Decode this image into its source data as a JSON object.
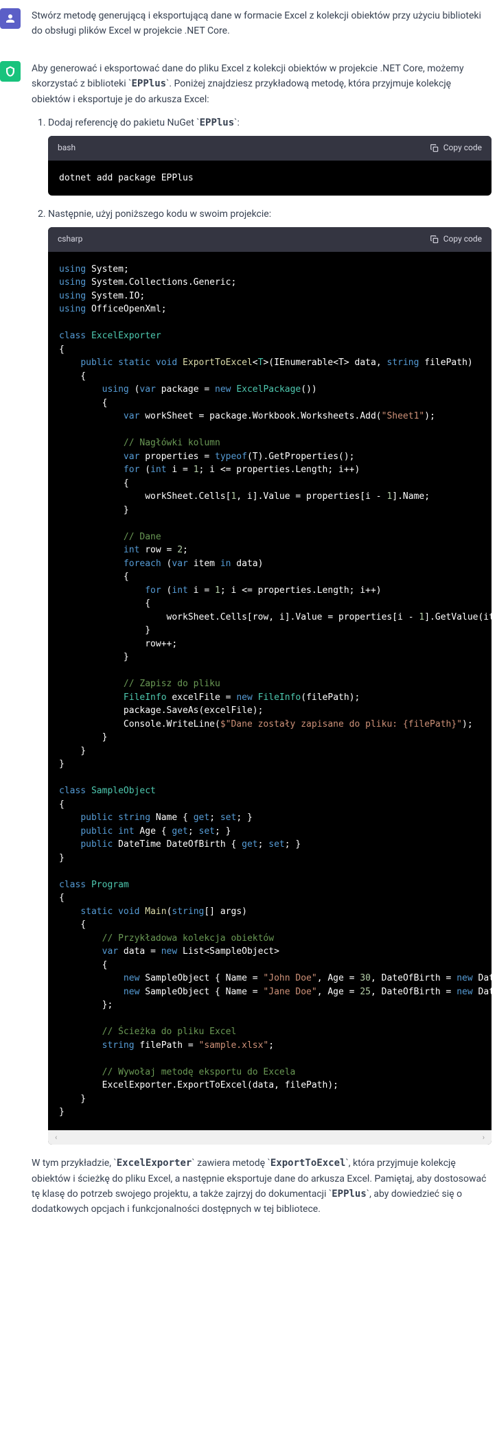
{
  "user": {
    "text": "Stwórz metodę generującą i eksportującą dane w formacie Excel z kolekcji obiektów przy użyciu biblioteki do obsługi plików Excel w projekcie .NET Core."
  },
  "assistant": {
    "intro_p1": "Aby generować i eksportować dane do pliku Excel z kolekcji obiektów w projekcie .NET Core, możemy skorzystać z biblioteki ",
    "intro_code": "EPPlus",
    "intro_p2": ". Poniżej znajdziesz przykładową metodę, która przyjmuje kolekcję obiektów i eksportuje je do arkusza Excel:",
    "step1_text": "Dodaj referencję do pakietu NuGet ",
    "step1_code": "EPPlus",
    "step1_suffix": ":",
    "bash_lang": "bash",
    "bash_cmd": "dotnet add package EPPlus",
    "step2_text": "Następnie, użyj poniższego kodu w swoim projekcie:",
    "csharp_lang": "csharp",
    "copy_label": "Copy code",
    "outro_p1": "W tym przykładzie, ",
    "outro_c1": "ExcelExporter",
    "outro_p2": " zawiera metodę ",
    "outro_c2": "ExportToExcel",
    "outro_p3": ", która przyjmuje kolekcję obiektów i ścieżkę do pliku Excel, a następnie eksportuje dane do arkusza Excel. Pamiętaj, aby dostosować tę klasę do potrzeb swojego projektu, a także zajrzyj do dokumentacji ",
    "outro_c3": "EPPlus",
    "outro_p4": ", aby dowiedzieć się o dodatkowych opcjach i funkcjonalności dostępnych w tej bibliotece."
  },
  "code": {
    "u_system": "System",
    "u_coll": "System.Collections.Generic",
    "u_io": "System.IO",
    "u_office": "OfficeOpenXml",
    "cls_exporter": "ExcelExporter",
    "fn_export": "ExportToExcel",
    "param_data": "data",
    "param_path": "filePath",
    "var_pkg": "package",
    "cls_pkg": "ExcelPackage",
    "var_ws": "workSheet",
    "str_sheet": "\"Sheet1\"",
    "com_headers": "// Nagłówki kolumn",
    "var_props": "properties",
    "com_data": "// Dane",
    "var_row": "row",
    "var_item": "item",
    "com_save": "// Zapisz do pliku",
    "var_file": "excelFile",
    "cls_fileinfo": "FileInfo",
    "str_saved": "$\"Dane zostały zapisane do pliku: {filePath}\"",
    "cls_sample": "SampleObject",
    "prop_name": "Name",
    "prop_age": "Age",
    "prop_dob": "DateOfBirth",
    "cls_program": "Program",
    "fn_main": "Main",
    "com_sample": "// Przykładowa kolekcja obiektów",
    "str_john": "\"John Doe\"",
    "str_jane": "\"Jane Doe\"",
    "num_30": "30",
    "num_25": "25",
    "com_path": "// Ścieżka do pliku Excel",
    "str_xlsx": "\"sample.xlsx\"",
    "com_call": "// Wywołaj metodę eksportu do Excela"
  }
}
